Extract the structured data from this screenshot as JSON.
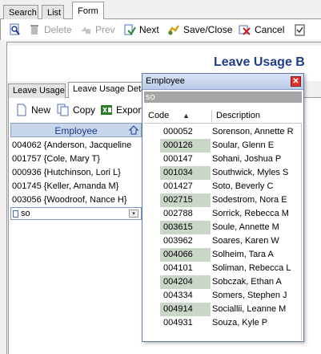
{
  "top_tabs": [
    {
      "label": "Search",
      "active": false
    },
    {
      "label": "List",
      "active": false
    },
    {
      "label": "Form",
      "active": true
    }
  ],
  "toolbar": {
    "search_icon": "magnifier-document-icon",
    "delete_label": "Delete",
    "prev_label": "Prev",
    "next_label": "Next",
    "save_close_label": "Save/Close",
    "cancel_label": "Cancel"
  },
  "banner": {
    "title": "Leave Usage B"
  },
  "sub_tabs": [
    {
      "label": "Leave Usage",
      "active": false
    },
    {
      "label": "Leave Usage Deta",
      "active": true
    }
  ],
  "sub_toolbar": {
    "new_label": "New",
    "copy_label": "Copy",
    "export_label": "Export"
  },
  "grid": {
    "header": "Employee",
    "rows": [
      "004062 {Anderson, Jacqueline",
      "001757 {Cole, Mary T}",
      "000936 {Hutchinson, Lori L}",
      "001745 {Keller, Amanda M}",
      "003056 {Woodroof, Nance H}"
    ],
    "input_value": "so",
    "dropdown_glyph": "▾"
  },
  "popup": {
    "title": "Employee",
    "close_glyph": "✕",
    "search_value": "so",
    "col_code": "Code",
    "col_desc": "Description",
    "sort_glyph": "▲",
    "rows": [
      {
        "code": "000052",
        "desc": "Sorenson, Annette R"
      },
      {
        "code": "000126",
        "desc": "Soular, Glenn E"
      },
      {
        "code": "000147",
        "desc": "Sohani, Joshua P"
      },
      {
        "code": "001034",
        "desc": "Southwick, Myles S"
      },
      {
        "code": "001427",
        "desc": "Soto, Beverly C"
      },
      {
        "code": "002715",
        "desc": "Sodestrom, Nora E"
      },
      {
        "code": "002788",
        "desc": "Sorrick, Rebecca M"
      },
      {
        "code": "003615",
        "desc": "Soule, Annette M"
      },
      {
        "code": "003962",
        "desc": "Soares, Karen W"
      },
      {
        "code": "004066",
        "desc": "Solheim, Tara A"
      },
      {
        "code": "004101",
        "desc": "Soliman, Rebecca L"
      },
      {
        "code": "004204",
        "desc": "Sobczak, Ethan A"
      },
      {
        "code": "004334",
        "desc": "Somers, Stephen J"
      },
      {
        "code": "004914",
        "desc": "Sociallii, Leanne M"
      },
      {
        "code": "004931",
        "desc": "Souza, Kyle P"
      }
    ]
  }
}
